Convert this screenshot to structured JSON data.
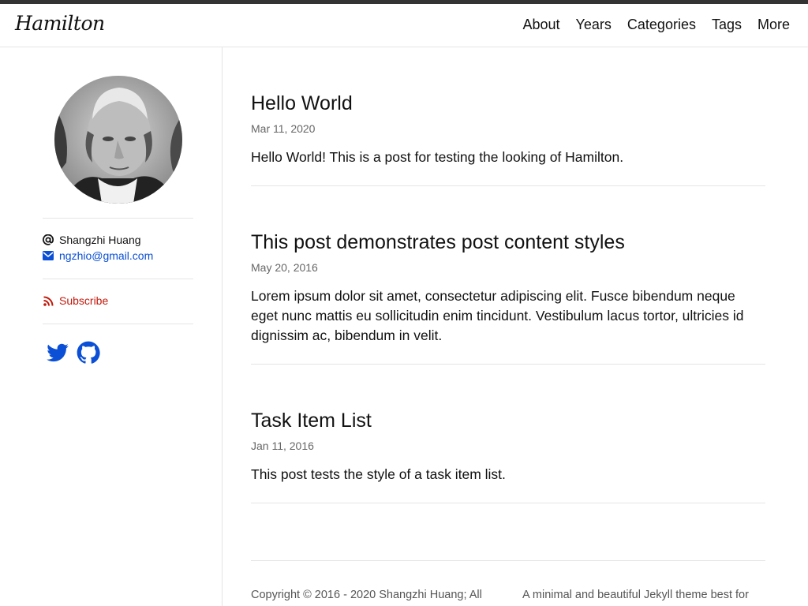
{
  "site": {
    "logo": "Hamilton"
  },
  "nav": [
    {
      "label": "About"
    },
    {
      "label": "Years"
    },
    {
      "label": "Categories"
    },
    {
      "label": "Tags"
    },
    {
      "label": "More"
    }
  ],
  "sidebar": {
    "author": "Shangzhi Huang",
    "email": "ngzhio@gmail.com",
    "subscribe": "Subscribe",
    "social": [
      "twitter-icon",
      "github-icon"
    ]
  },
  "posts": [
    {
      "title": "Hello World",
      "date": "Mar 11, 2020",
      "excerpt": "Hello World! This is a post for testing the looking of Hamilton."
    },
    {
      "title": "This post demonstrates post content styles",
      "date": "May 20, 2016",
      "excerpt": "Lorem ipsum dolor sit amet, consectetur adipiscing elit. Fusce bibendum neque eget nunc mattis eu sollicitudin enim tincidunt. Vestibulum lacus tortor, ultricies id dignissim ac, bibendum in velit."
    },
    {
      "title": "Task Item List",
      "date": "Jan 11, 2016",
      "excerpt": "This post tests the style of a task item list."
    }
  ],
  "footer": {
    "copyright": "Copyright © 2016 - 2020 Shangzhi Huang; All",
    "tagline": "A minimal and beautiful Jekyll theme best for"
  },
  "colors": {
    "link": "#0b4fd6",
    "subscribe": "#c0180a",
    "topbar": "#333333"
  }
}
